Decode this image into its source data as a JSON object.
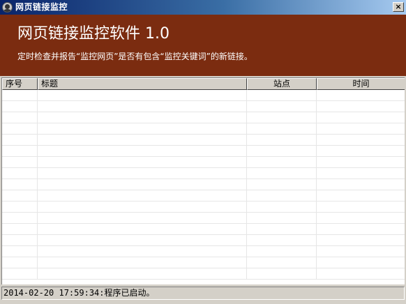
{
  "window": {
    "title": "网页链接监控",
    "icon": "monitor-app-icon",
    "close_glyph": "×"
  },
  "banner": {
    "title": "网页链接监控软件 1.0",
    "subtitle": "定时检查并报告“监控网页”是否有包含“监控关键词”的新链接。",
    "background": "#7b2c10"
  },
  "table": {
    "columns": [
      "序号",
      "标题",
      "站点",
      "时间"
    ],
    "rows": []
  },
  "status": {
    "text": "2014-02-20 17:59:34:程序已启动。"
  }
}
